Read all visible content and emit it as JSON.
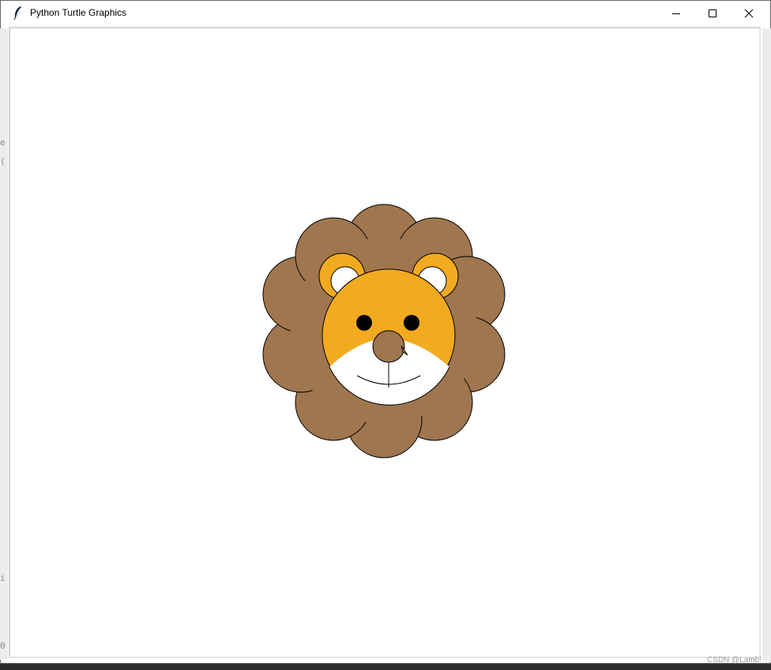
{
  "window": {
    "title": "Python Turtle Graphics",
    "controls": {
      "minimize": "minimize",
      "maximize": "maximize",
      "close": "close"
    }
  },
  "icons": {
    "app": "feather-icon",
    "minimize": "minimize-icon",
    "maximize": "maximize-icon",
    "close": "close-icon"
  },
  "colors": {
    "mane": "#A0764E",
    "face": "#F2AB1F",
    "muzzle": "#FFFFFF",
    "nose": "#A0764E",
    "eyes": "#000000",
    "outline": "#000000",
    "ear_inner": "#FFFFFF"
  },
  "watermark": "CSDN @Lamb!"
}
